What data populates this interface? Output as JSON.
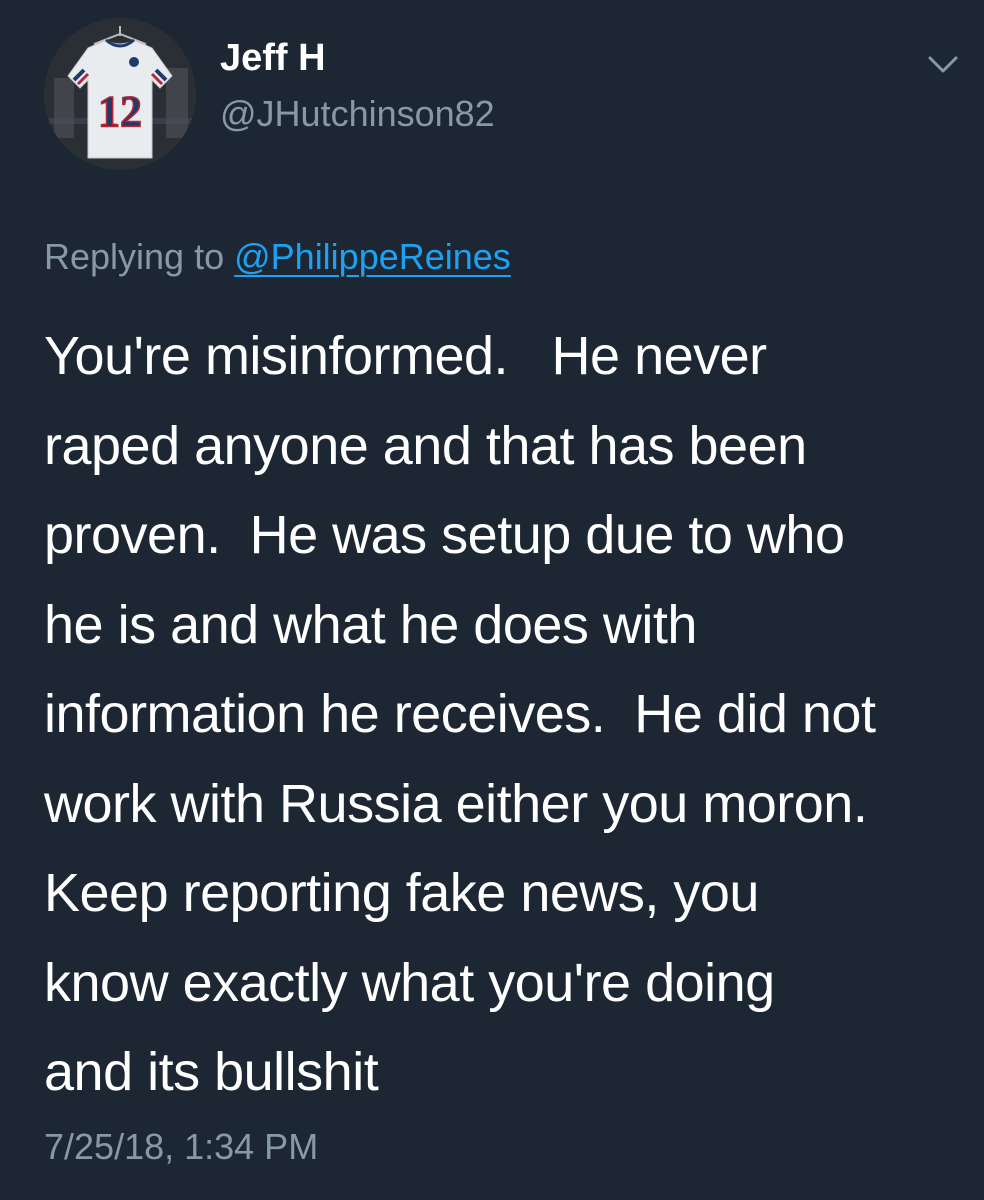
{
  "colors": {
    "background": "#1c2733",
    "text_primary": "#ffffff",
    "text_secondary": "#8899a6",
    "link": "#1da1f2"
  },
  "author": {
    "display_name": "Jeff H",
    "handle": "@JHutchinson82",
    "avatar_icon": "jersey-avatar",
    "avatar_jersey_number": "12"
  },
  "menu": {
    "icon": "chevron-down-icon"
  },
  "reply_context": {
    "prefix": "Replying to ",
    "mention": "@PhilippeReines"
  },
  "tweet": {
    "lines": [
      "You're misinformed.   He never",
      "raped anyone and that has been",
      "proven.  He was setup due to who",
      "he is and what he does with",
      "information he receives.  He did not",
      "work with Russia either you moron.",
      "Keep reporting fake news, you",
      "know exactly what you're doing",
      "and its bullshit"
    ],
    "timestamp": "7/25/18, 1:34 PM"
  }
}
